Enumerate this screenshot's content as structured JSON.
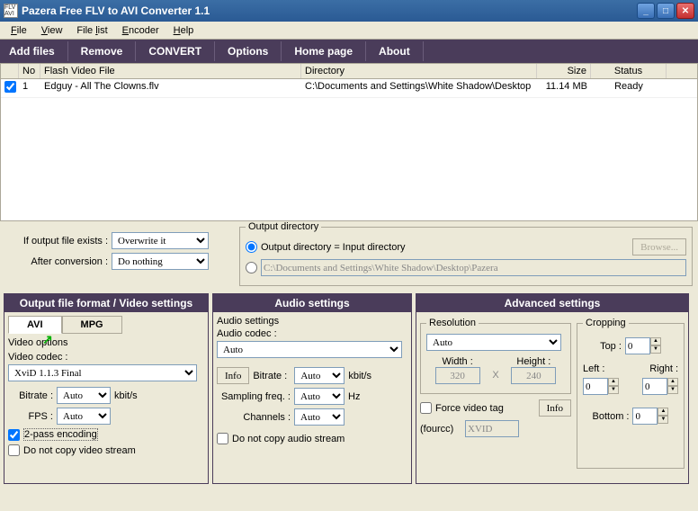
{
  "window": {
    "title": "Pazera Free FLV to AVI Converter 1.1",
    "icon": "FLV AVI"
  },
  "menu": [
    "File",
    "View",
    "File list",
    "Encoder",
    "Help"
  ],
  "menuUnder": [
    "F",
    "V",
    "l",
    "E",
    "H"
  ],
  "toolbar": [
    "Add files",
    "Remove",
    "CONVERT",
    "Options",
    "Home page",
    "About"
  ],
  "columns": {
    "no": "No",
    "file": "Flash Video File",
    "dir": "Directory",
    "size": "Size",
    "status": "Status"
  },
  "rows": [
    {
      "checked": true,
      "no": "1",
      "file": "Edguy - All The Clowns.flv",
      "dir": "C:\\Documents and Settings\\White Shadow\\Desktop",
      "size": "11.14 MB",
      "status": "Ready"
    }
  ],
  "ifexists": {
    "label": "If output file exists :",
    "value": "Overwrite it"
  },
  "afterconv": {
    "label": "After conversion :",
    "value": "Do nothing"
  },
  "outdir": {
    "title": "Output directory",
    "opt1": "Output directory = Input directory",
    "path": "C:\\Documents and Settings\\White Shadow\\Desktop\\Pazera",
    "browse": "Browse..."
  },
  "panels": {
    "video": {
      "title": "Output file format / Video settings",
      "tabs": [
        "AVI",
        "MPG"
      ],
      "voHeader": "Video options",
      "codecLabel": "Video codec :",
      "codec": "XviD 1.1.3 Final",
      "bitrateLabel": "Bitrate :",
      "bitrate": "Auto",
      "bitrateUnit": "kbit/s",
      "fpsLabel": "FPS :",
      "fps": "Auto",
      "twopass": "2-pass encoding",
      "nocopy": "Do not copy video stream"
    },
    "audio": {
      "title": "Audio settings",
      "asHeader": "Audio settings",
      "codecLabel": "Audio codec :",
      "codec": "Auto",
      "info": "Info",
      "bitrateLabel": "Bitrate :",
      "bitrate": "Auto",
      "bitrateUnit": "kbit/s",
      "sampLabel": "Sampling freq. :",
      "samp": "Auto",
      "sampUnit": "Hz",
      "chLabel": "Channels :",
      "ch": "Auto",
      "nocopy": "Do not copy audio stream"
    },
    "adv": {
      "title": "Advanced settings",
      "resLabel": "Resolution",
      "res": "Auto",
      "widthLabel": "Width :",
      "width": "320",
      "heightLabel": "Height :",
      "height": "240",
      "forcetag": "Force video tag",
      "info": "Info",
      "fourccLabel": "(fourcc)",
      "fourcc": "XVID",
      "cropLabel": "Cropping",
      "top": "Top :",
      "left": "Left :",
      "right": "Right :",
      "bottom": "Bottom :",
      "zero": "0"
    }
  }
}
